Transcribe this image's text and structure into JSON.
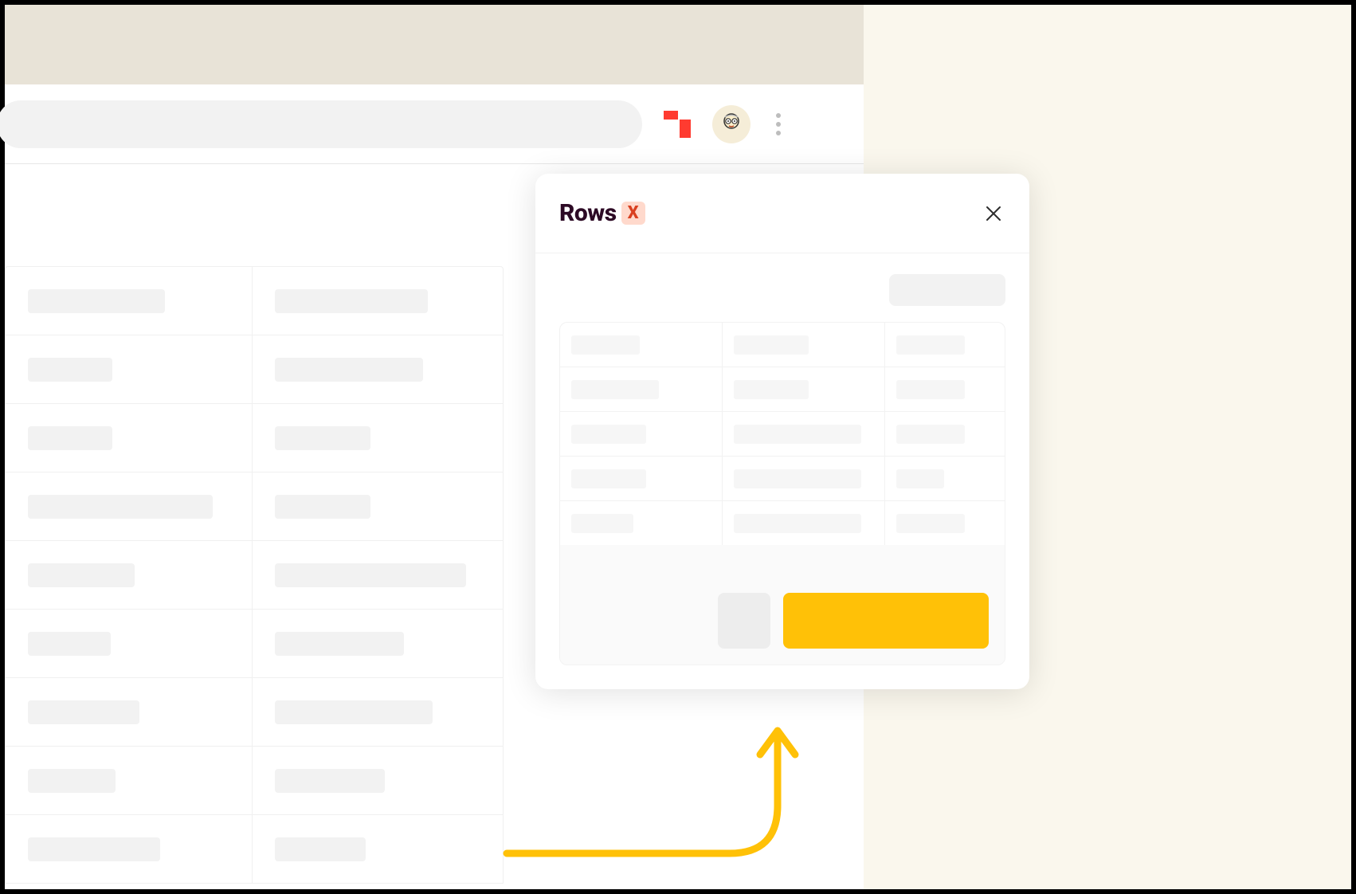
{
  "popup": {
    "title": "Rows",
    "badge": "X"
  },
  "colors": {
    "accent_yellow": "#ffc107",
    "brand_red": "#ff3b30",
    "badge_bg": "#ffd9cc",
    "badge_fg": "#d94020"
  },
  "bg_table": {
    "rows": [
      {
        "c1_width": 172,
        "c2_width": 192
      },
      {
        "c1_width": 106,
        "c2_width": 186
      },
      {
        "c1_width": 106,
        "c2_width": 120
      },
      {
        "c1_width": 232,
        "c2_width": 120
      },
      {
        "c1_width": 134,
        "c2_width": 240
      },
      {
        "c1_width": 104,
        "c2_width": 162
      },
      {
        "c1_width": 140,
        "c2_width": 198
      },
      {
        "c1_width": 110,
        "c2_width": 138
      },
      {
        "c1_width": 166,
        "c2_width": 114
      }
    ]
  },
  "mini_table": {
    "rows": [
      {
        "c1": 86,
        "c2": 94,
        "c3": 86
      },
      {
        "c1": 110,
        "c2": 94,
        "c3": 86
      },
      {
        "c1": 94,
        "c2": 160,
        "c3": 86
      },
      {
        "c1": 94,
        "c2": 160,
        "c3": 60
      },
      {
        "c1": 78,
        "c2": 160,
        "c3": 86
      }
    ]
  }
}
